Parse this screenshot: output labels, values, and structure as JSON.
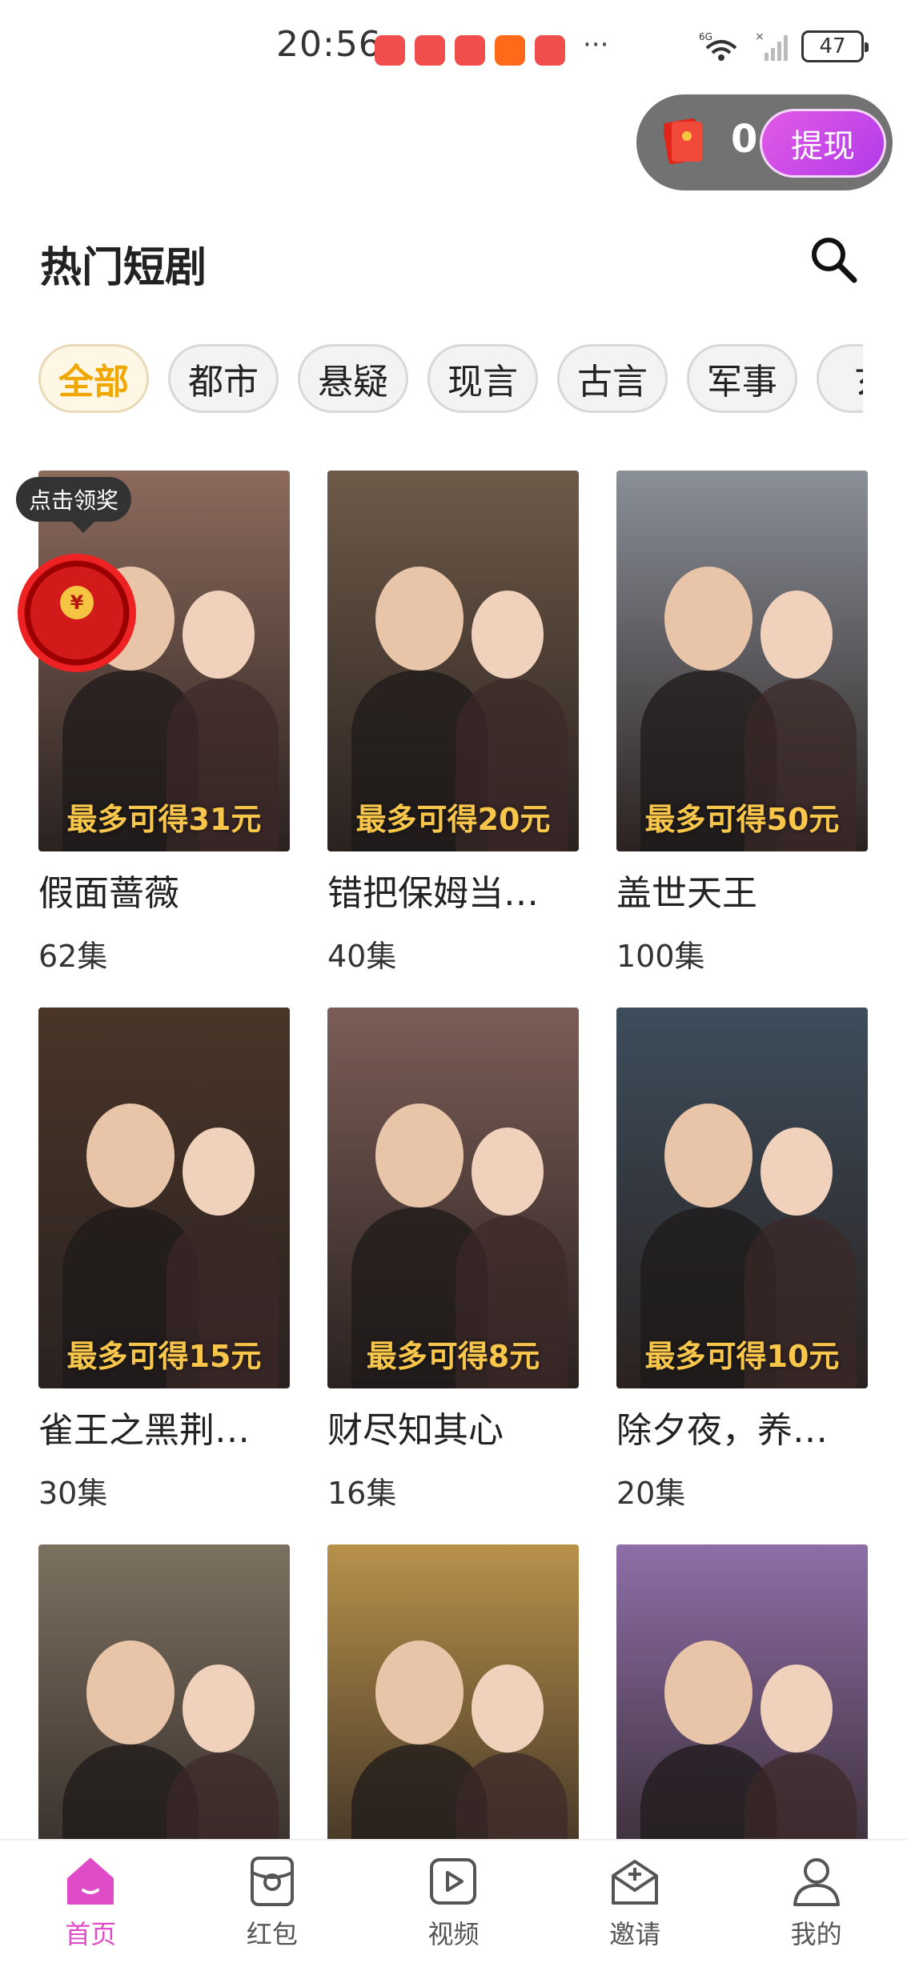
{
  "status_bar": {
    "time": "20:56",
    "more": "···",
    "network": "6G",
    "battery": "47"
  },
  "reward": {
    "count": "0",
    "withdraw_label": "提现"
  },
  "header": {
    "title": "热门短剧"
  },
  "categories": [
    "全部",
    "都市",
    "悬疑",
    "现言",
    "古言",
    "军事",
    "玄"
  ],
  "claim_badge": "点击领奖",
  "dramas": [
    {
      "title": "假面蔷薇",
      "episodes": "62集",
      "reward": "最多可得31元",
      "bg": "#8c6a5c"
    },
    {
      "title": "错把保姆当…",
      "episodes": "40集",
      "reward": "最多可得20元",
      "bg": "#6e5a48"
    },
    {
      "title": "盖世天王",
      "episodes": "100集",
      "reward": "最多可得50元",
      "bg": "#8a8f98"
    },
    {
      "title": "雀王之黑荆…",
      "episodes": "30集",
      "reward": "最多可得15元",
      "bg": "#4a3528"
    },
    {
      "title": "财尽知其心",
      "episodes": "16集",
      "reward": "最多可得8元",
      "bg": "#7c5d57"
    },
    {
      "title": "除夕夜，养…",
      "episodes": "20集",
      "reward": "最多可得10元",
      "bg": "#3d4d5c"
    },
    {
      "title": "",
      "episodes": "",
      "reward": "",
      "bg": "#7c7060"
    },
    {
      "title": "",
      "episodes": "",
      "reward": "",
      "bg": "#b8914a"
    },
    {
      "title": "",
      "episodes": "",
      "reward": "",
      "bg": "#8e6ea8"
    }
  ],
  "nav": [
    {
      "label": "首页"
    },
    {
      "label": "红包"
    },
    {
      "label": "视频"
    },
    {
      "label": "邀请"
    },
    {
      "label": "我的"
    }
  ],
  "colors": {
    "accent": "#e04cc8",
    "chip_active": "#f0a800",
    "reward_text": "#f7c64a"
  }
}
